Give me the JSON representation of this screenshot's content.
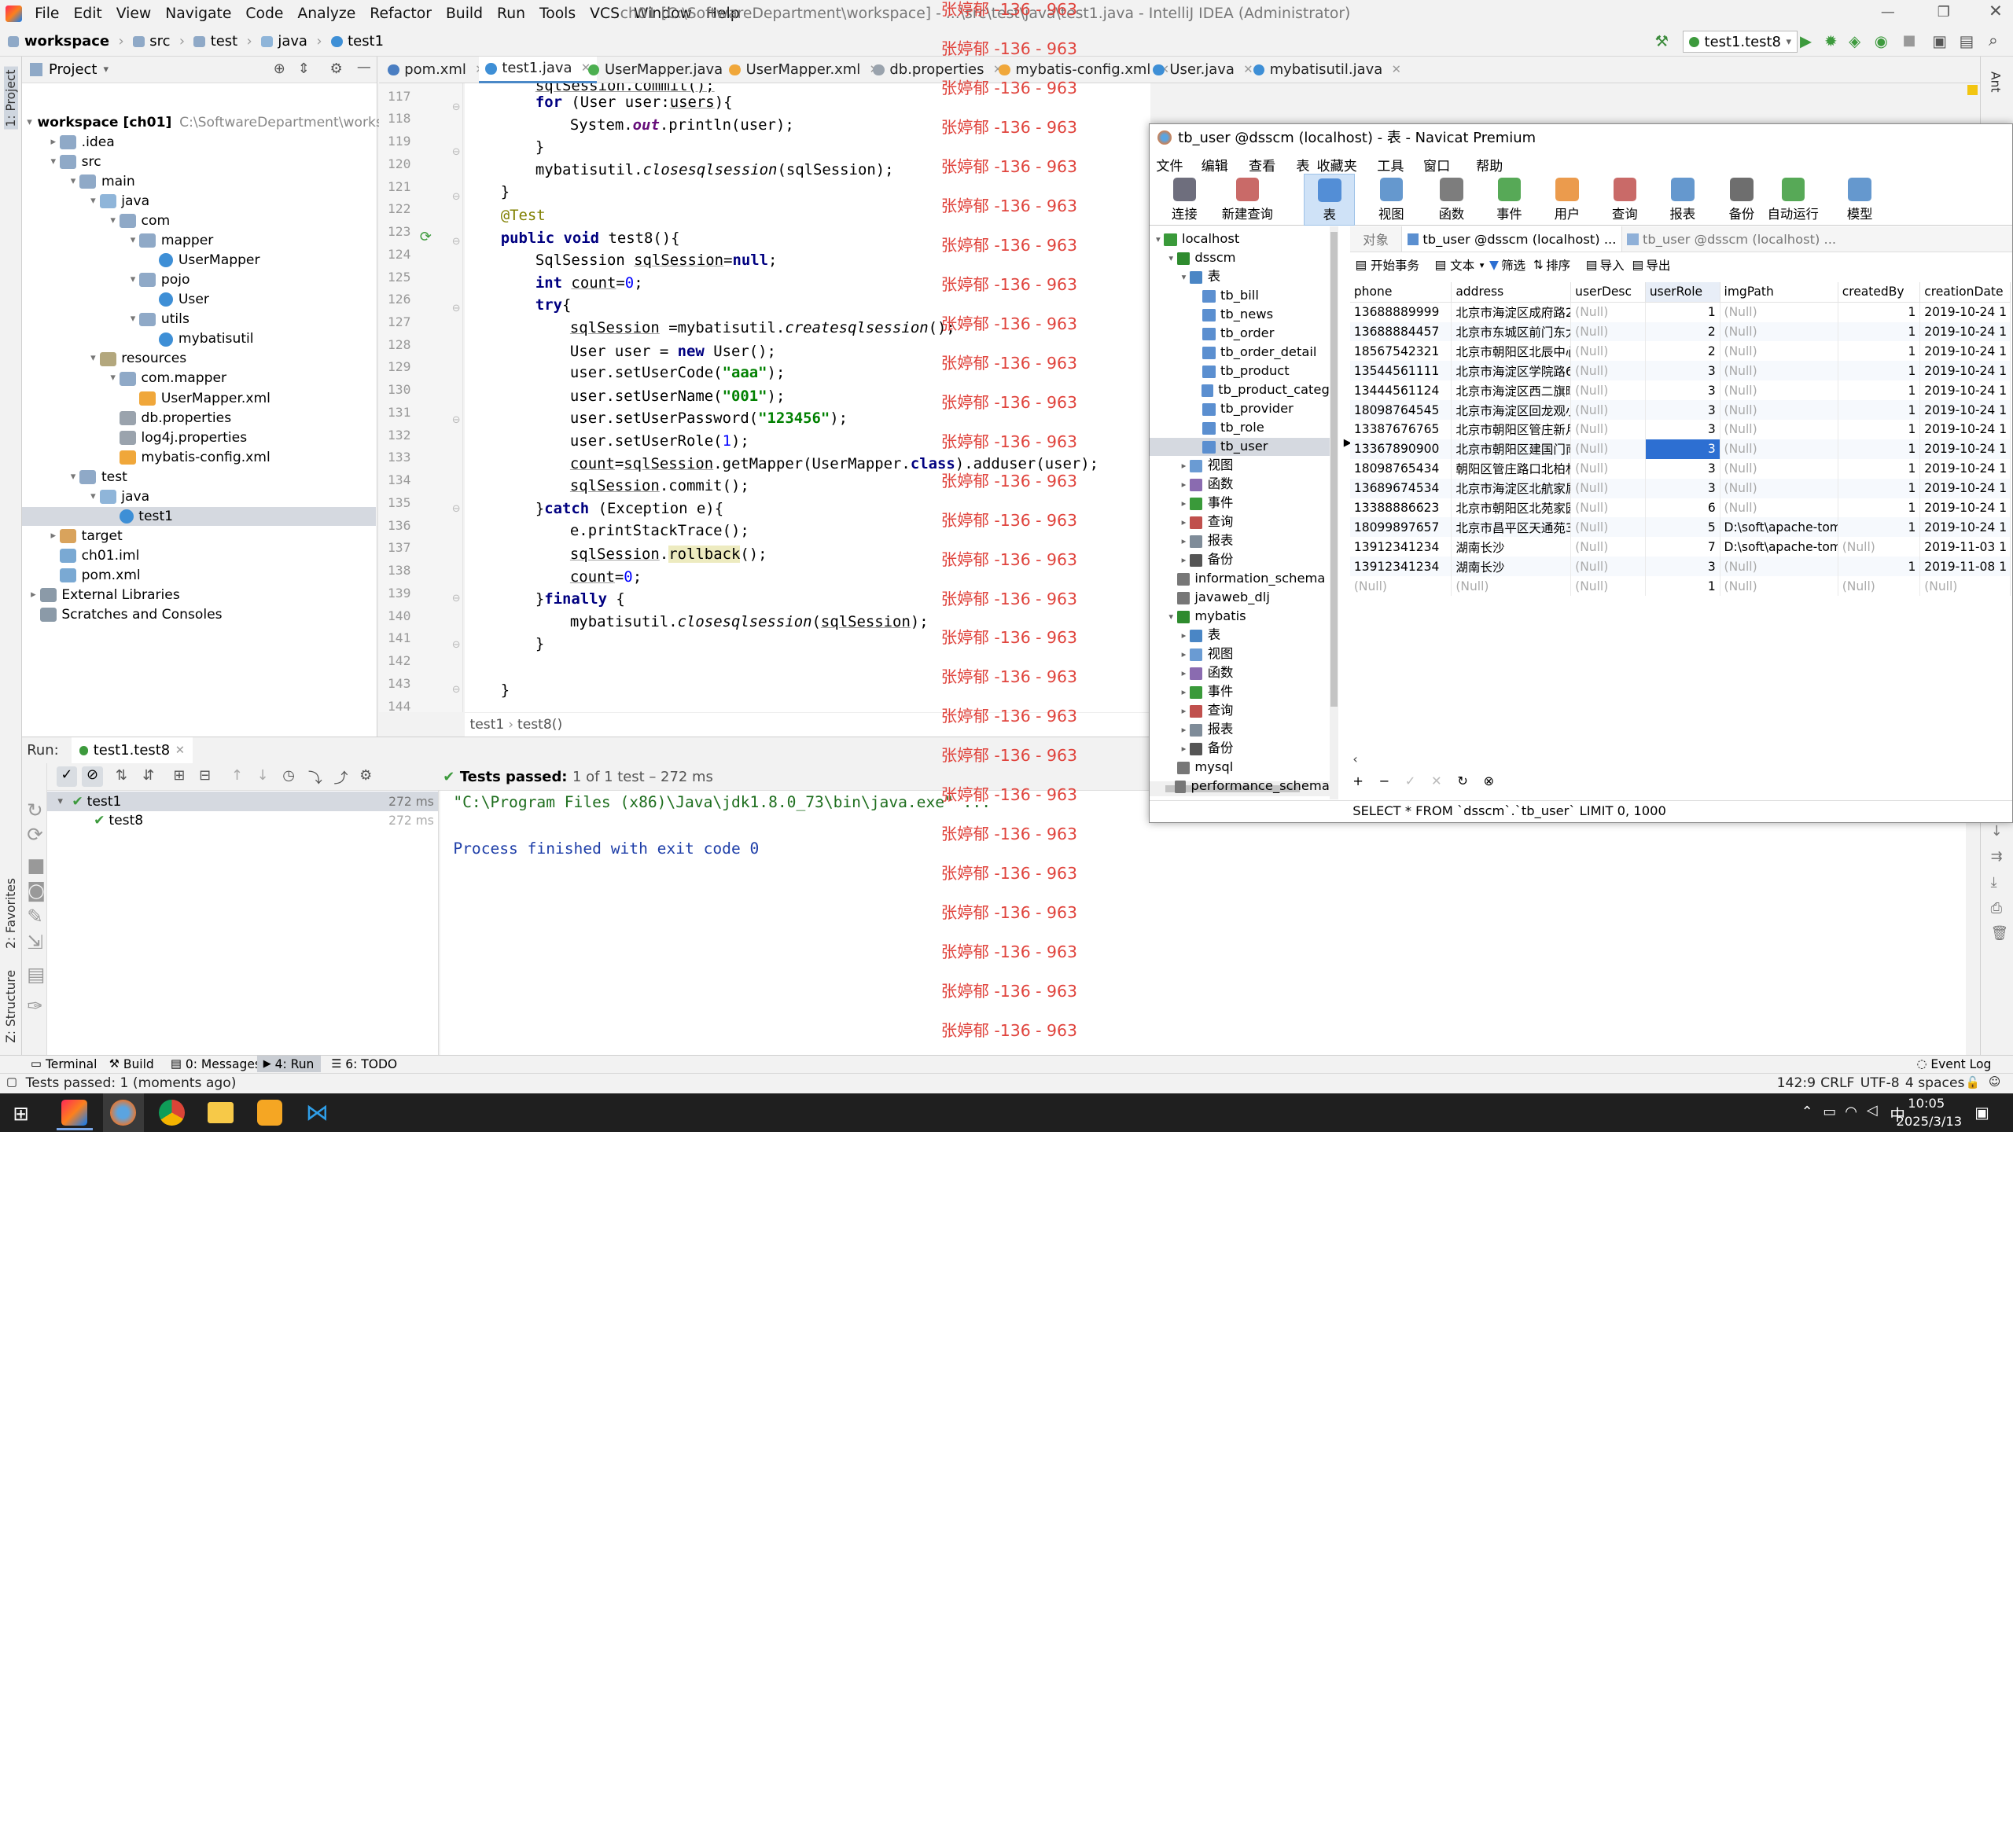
{
  "window": {
    "title": "ch01 [C:\\SoftwareDepartment\\workspace] - ...\\src\\test\\java\\test1.java - IntelliJ IDEA (Administrator)"
  },
  "menu": [
    "File",
    "Edit",
    "View",
    "Navigate",
    "Code",
    "Analyze",
    "Refactor",
    "Build",
    "Run",
    "Tools",
    "VCS",
    "Window",
    "Help"
  ],
  "breadcrumb": [
    "workspace",
    "src",
    "test",
    "java",
    "test1"
  ],
  "run_config": "test1.test8",
  "project": {
    "header": "Project",
    "tree": [
      {
        "label": "workspace [ch01]",
        "extra": "C:\\SoftwareDepartment\\workspace",
        "indent": 0,
        "arrow": "▾",
        "icon": "fold"
      },
      {
        "label": ".idea",
        "indent": 1,
        "arrow": "▸",
        "icon": "fold"
      },
      {
        "label": "src",
        "indent": 1,
        "arrow": "▾",
        "icon": "fold"
      },
      {
        "label": "main",
        "indent": 2,
        "arrow": "▾",
        "icon": "fold"
      },
      {
        "label": "java",
        "indent": 3,
        "arrow": "▾",
        "icon": "foldj"
      },
      {
        "label": "com",
        "indent": 4,
        "arrow": "▾",
        "icon": "fold"
      },
      {
        "label": "mapper",
        "indent": 5,
        "arrow": "▾",
        "icon": "fold"
      },
      {
        "label": "UserMapper",
        "indent": 6,
        "arrow": "",
        "icon": "cls"
      },
      {
        "label": "pojo",
        "indent": 5,
        "arrow": "▾",
        "icon": "fold"
      },
      {
        "label": "User",
        "indent": 6,
        "arrow": "",
        "icon": "cls"
      },
      {
        "label": "utils",
        "indent": 5,
        "arrow": "▾",
        "icon": "fold"
      },
      {
        "label": "mybatisutil",
        "indent": 6,
        "arrow": "",
        "icon": "cls"
      },
      {
        "label": "resources",
        "indent": 3,
        "arrow": "▾",
        "icon": "foldr"
      },
      {
        "label": "com.mapper",
        "indent": 4,
        "arrow": "▾",
        "icon": "fold"
      },
      {
        "label": "UserMapper.xml",
        "indent": 5,
        "arrow": "",
        "icon": "xmlic"
      },
      {
        "label": "db.properties",
        "indent": 4,
        "arrow": "",
        "icon": "propic"
      },
      {
        "label": "log4j.properties",
        "indent": 4,
        "arrow": "",
        "icon": "propic"
      },
      {
        "label": "mybatis-config.xml",
        "indent": 4,
        "arrow": "",
        "icon": "xmlic"
      },
      {
        "label": "test",
        "indent": 2,
        "arrow": "▾",
        "icon": "fold"
      },
      {
        "label": "java",
        "indent": 3,
        "arrow": "▾",
        "icon": "foldj"
      },
      {
        "label": "test1",
        "indent": 4,
        "arrow": "",
        "icon": "cls",
        "selected": true
      },
      {
        "label": "target",
        "indent": 1,
        "arrow": "▸",
        "icon": "foldo"
      },
      {
        "label": "ch01.iml",
        "indent": 1,
        "arrow": "",
        "icon": "modic"
      },
      {
        "label": "pom.xml",
        "indent": 1,
        "arrow": "",
        "icon": "modic"
      },
      {
        "label": "External Libraries",
        "indent": 0,
        "arrow": "▸",
        "icon": "libic"
      },
      {
        "label": "Scratches and Consoles",
        "indent": 0,
        "arrow": "",
        "icon": "libic"
      }
    ]
  },
  "tabs": [
    {
      "label": "pom.xml",
      "color": "#4a7ec2"
    },
    {
      "label": "test1.java",
      "color": "#3e8fd6",
      "active": true
    },
    {
      "label": "UserMapper.java",
      "color": "#4caf50"
    },
    {
      "label": "UserMapper.xml",
      "color": "#f0a73a"
    },
    {
      "label": "db.properties",
      "color": "#9aa3ad"
    },
    {
      "label": "mybatis-config.xml",
      "color": "#f0a73a"
    },
    {
      "label": "User.java",
      "color": "#3e8fd6"
    },
    {
      "label": "mybatisutil.java",
      "color": "#3e8fd6"
    }
  ],
  "editor": {
    "line_numbers": [
      "117",
      "118",
      "119",
      "120",
      "121",
      "122",
      "123",
      "124",
      "125",
      "126",
      "127",
      "128",
      "129",
      "130",
      "131",
      "132",
      "133",
      "134",
      "135",
      "136",
      "137",
      "138",
      "139",
      "140",
      "141",
      "142",
      "143",
      "144"
    ],
    "breadcrumb": [
      "test1",
      "test8()"
    ],
    "strings": {
      "aaa": "\"aaa\"",
      "n001": "\"001\"",
      "pwd": "\"123456\""
    }
  },
  "watermark": "张婷郁 -136 - 963",
  "run": {
    "label": "Run:",
    "config": "test1.test8",
    "status_prefix": "Tests passed:",
    "status_detail": "1 of 1 test – 272 ms",
    "tree": [
      {
        "label": "test1",
        "time": "272 ms"
      },
      {
        "label": "test8",
        "time": "272 ms"
      }
    ],
    "console": [
      "\"C:\\Program Files (x86)\\Java\\jdk1.8.0_73\\bin\\java.exe\" ...",
      "",
      "Process finished with exit code 0"
    ]
  },
  "bottom_tabs": [
    "Terminal",
    "Build",
    "0: Messages",
    "4: Run",
    "6: TODO",
    "Event Log"
  ],
  "left_stripe": [
    "1: Project",
    "2: Favorites",
    "Z: Structure"
  ],
  "right_stripe": [
    "Ant"
  ],
  "status": {
    "message": "Tests passed: 1 (moments ago)",
    "position": "142:9",
    "line_sep": "CRLF",
    "encoding": "UTF-8",
    "indent": "4 spaces"
  },
  "taskbar": {
    "time": "10:05",
    "date": "2025/3/13",
    "ime": "中"
  },
  "navicat": {
    "title": "tb_user @dsscm (localhost) - 表 - Navicat Premium",
    "menu": [
      "文件",
      "编辑",
      "查看",
      "表",
      "收藏夹",
      "工具",
      "窗口",
      "帮助"
    ],
    "toolbar": [
      "连接",
      "新建查询",
      "表",
      "视图",
      "函数",
      "事件",
      "用户",
      "查询",
      "报表",
      "备份",
      "自动运行",
      "模型"
    ],
    "tabs": [
      "对象",
      "tb_user @dsscm (localhost) ...",
      "tb_user @dsscm (localhost) ..."
    ],
    "grid_toolbar": [
      "开始事务",
      "文本",
      "筛选",
      "排序",
      "导入",
      "导出"
    ],
    "tree": [
      {
        "label": "localhost",
        "indent": 0,
        "arrow": "▾",
        "icon": "#3a9a3a"
      },
      {
        "label": "dsscm",
        "indent": 1,
        "arrow": "▾",
        "icon": "#2e8b2e"
      },
      {
        "label": "表",
        "indent": 2,
        "arrow": "▾",
        "icon": "#4a86c5"
      },
      {
        "label": "tb_bill",
        "indent": 3,
        "arrow": "",
        "icon": "#5b8fd0"
      },
      {
        "label": "tb_news",
        "indent": 3,
        "arrow": "",
        "icon": "#5b8fd0"
      },
      {
        "label": "tb_order",
        "indent": 3,
        "arrow": "",
        "icon": "#5b8fd0"
      },
      {
        "label": "tb_order_detail",
        "indent": 3,
        "arrow": "",
        "icon": "#5b8fd0"
      },
      {
        "label": "tb_product",
        "indent": 3,
        "arrow": "",
        "icon": "#5b8fd0"
      },
      {
        "label": "tb_product_categ",
        "indent": 3,
        "arrow": "",
        "icon": "#5b8fd0"
      },
      {
        "label": "tb_provider",
        "indent": 3,
        "arrow": "",
        "icon": "#5b8fd0"
      },
      {
        "label": "tb_role",
        "indent": 3,
        "arrow": "",
        "icon": "#5b8fd0"
      },
      {
        "label": "tb_user",
        "indent": 3,
        "arrow": "",
        "icon": "#5b8fd0",
        "selected": true
      },
      {
        "label": "视图",
        "indent": 2,
        "arrow": "▸",
        "icon": "#6a9bd3"
      },
      {
        "label": "函数",
        "indent": 2,
        "arrow": "▸",
        "icon": "#8a6bb0"
      },
      {
        "label": "事件",
        "indent": 2,
        "arrow": "▸",
        "icon": "#3a9a3a"
      },
      {
        "label": "查询",
        "indent": 2,
        "arrow": "▸",
        "icon": "#c0504d"
      },
      {
        "label": "报表",
        "indent": 2,
        "arrow": "▸",
        "icon": "#7f8c99"
      },
      {
        "label": "备份",
        "indent": 2,
        "arrow": "▸",
        "icon": "#555"
      },
      {
        "label": "information_schema",
        "indent": 1,
        "arrow": "",
        "icon": "#777"
      },
      {
        "label": "javaweb_dlj",
        "indent": 1,
        "arrow": "",
        "icon": "#777"
      },
      {
        "label": "mybatis",
        "indent": 1,
        "arrow": "▾",
        "icon": "#2e8b2e"
      },
      {
        "label": "表",
        "indent": 2,
        "arrow": "▸",
        "icon": "#4a86c5"
      },
      {
        "label": "视图",
        "indent": 2,
        "arrow": "▸",
        "icon": "#6a9bd3"
      },
      {
        "label": "函数",
        "indent": 2,
        "arrow": "▸",
        "icon": "#8a6bb0"
      },
      {
        "label": "事件",
        "indent": 2,
        "arrow": "▸",
        "icon": "#3a9a3a"
      },
      {
        "label": "查询",
        "indent": 2,
        "arrow": "▸",
        "icon": "#c0504d"
      },
      {
        "label": "报表",
        "indent": 2,
        "arrow": "▸",
        "icon": "#7f8c99"
      },
      {
        "label": "备份",
        "indent": 2,
        "arrow": "▸",
        "icon": "#555"
      },
      {
        "label": "mysql",
        "indent": 1,
        "arrow": "",
        "icon": "#777"
      },
      {
        "label": "performance_schema",
        "indent": 1,
        "arrow": "",
        "icon": "#777"
      }
    ],
    "columns": [
      "phone",
      "address",
      "userDesc",
      "userRole",
      "imgPath",
      "createdBy",
      "creationDate"
    ],
    "rows": [
      [
        "13688889999",
        "北京市海淀区成府路2(",
        "(Null)",
        "1",
        "(Null)",
        "1",
        "2019-10-24 1"
      ],
      [
        "13688884457",
        "北京市东城区前门东大",
        "(Null)",
        "2",
        "(Null)",
        "1",
        "2019-10-24 1"
      ],
      [
        "18567542321",
        "北京市朝阳区北辰中心",
        "(Null)",
        "2",
        "(Null)",
        "1",
        "2019-10-24 1"
      ],
      [
        "13544561111",
        "北京市海淀区学院路6",
        "(Null)",
        "3",
        "(Null)",
        "1",
        "2019-10-24 1"
      ],
      [
        "13444561124",
        "北京市海淀区西二旗晖",
        "(Null)",
        "3",
        "(Null)",
        "1",
        "2019-10-24 1"
      ],
      [
        "18098764545",
        "北京市海淀区回龙观小",
        "(Null)",
        "3",
        "(Null)",
        "1",
        "2019-10-24 1"
      ],
      [
        "13387676765",
        "北京市朝阳区管庄新月",
        "(Null)",
        "3",
        "(Null)",
        "1",
        "2019-10-24 1"
      ],
      [
        "13367890900",
        "北京市朝阳区建国门南",
        "(Null)",
        "3",
        "(Null)",
        "1",
        "2019-10-24 1"
      ],
      [
        "18098765434",
        "朝阳区管庄路口北柏林",
        "(Null)",
        "3",
        "(Null)",
        "1",
        "2019-10-24 1"
      ],
      [
        "13689674534",
        "北京市海淀区北航家属",
        "(Null)",
        "3",
        "(Null)",
        "1",
        "2019-10-24 1"
      ],
      [
        "13388886623",
        "北京市朝阳区北苑家园",
        "(Null)",
        "6",
        "(Null)",
        "1",
        "2019-10-24 1"
      ],
      [
        "18099897657",
        "北京市昌平区天通苑3[",
        "(Null)",
        "5",
        "D:\\soft\\apache-tomc",
        "1",
        "2019-10-24 1"
      ],
      [
        "13912341234",
        "湖南长沙",
        "(Null)",
        "7",
        "D:\\soft\\apache-tomc",
        "(Null)",
        "2019-11-03 1"
      ],
      [
        "13912341234",
        "湖南长沙",
        "(Null)",
        "3",
        "(Null)",
        "1",
        "2019-11-08 1"
      ],
      [
        "(Null)",
        "(Null)",
        "(Null)",
        "1",
        "(Null)",
        "(Null)",
        "(Null)"
      ]
    ],
    "selected_row": 7,
    "sql": "SELECT * FROM `dsscm`.`tb_user` LIMIT 0, 1000"
  }
}
